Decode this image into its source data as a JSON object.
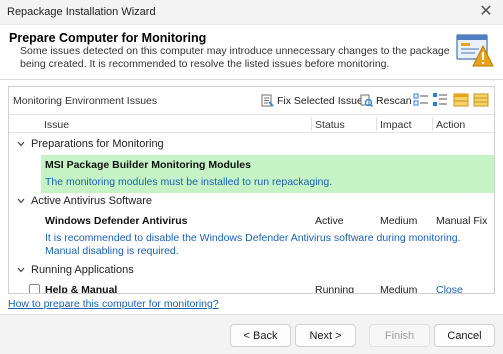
{
  "window": {
    "title": "Repackage Installation Wizard",
    "close_glyph": "✕"
  },
  "header": {
    "title": "Prepare Computer for Monitoring",
    "description": "Some issues detected on this computer may introduce unnecessary changes to the package being created. It is recommended to resolve the listed issues before monitoring.",
    "icon": "monitor-warning-icon"
  },
  "panel": {
    "title": "Monitoring Environment Issues",
    "toolbar": {
      "fix_label": "Fix Selected Issues",
      "rescan_label": "Rescan",
      "icons": [
        "expand-all-icon",
        "collapse-all-icon",
        "view-grouped-icon",
        "view-list-icon"
      ]
    },
    "columns": {
      "issue": "Issue",
      "status": "Status",
      "impact": "Impact",
      "action": "Action"
    },
    "groups": [
      {
        "label": "Preparations for Monitoring",
        "items": [
          {
            "title": "MSI Package Builder Monitoring Modules",
            "description": "The monitoring modules must be installed to run repackaging.",
            "status": "",
            "impact": "",
            "action": "",
            "highlighted": true
          }
        ]
      },
      {
        "label": "Active Antivirus Software",
        "items": [
          {
            "title": "Windows Defender Antivirus",
            "description": "It is recommended to disable the Windows Defender Antivirus software during monitoring. Manual disabling is required.",
            "status": "Active",
            "impact": "Medium",
            "action": "Manual Fix"
          }
        ]
      },
      {
        "label": "Running Applications",
        "items": [
          {
            "title": "Help & Manual",
            "status": "Running",
            "impact": "Medium",
            "action": "Close"
          }
        ]
      }
    ]
  },
  "help_link": "How to prepare this computer for monitoring?",
  "footer": {
    "back": "< Back",
    "next": "Next >",
    "finish": "Finish",
    "cancel": "Cancel"
  },
  "colors": {
    "highlight": "#c6f3c5",
    "link": "#1a62b3",
    "accent": "#e8a317"
  }
}
